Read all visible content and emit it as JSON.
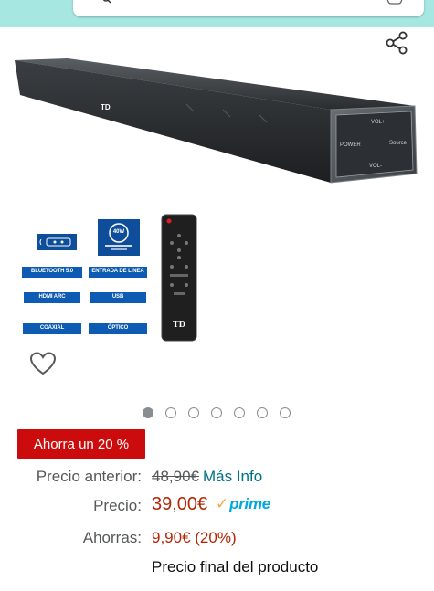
{
  "colors": {
    "top_bar": "#a6e7e2",
    "badge": "#cc0c0c",
    "price": "#b12704",
    "link": "#007185",
    "prime_blue": "#00a8e1",
    "prime_check": "#f3a847"
  },
  "header": {
    "search_icon": "search-icon",
    "right_icon": "camera-icon"
  },
  "share": {
    "icon": "share-icon"
  },
  "product": {
    "soundbar_labels": {
      "brand": "TD",
      "power": "POWER",
      "source": "Source",
      "vol_up": "VOL+",
      "vol_down": "VOL-"
    },
    "features": {
      "wattage": "40W",
      "bluetooth": "BLUETOOTH 5.0",
      "line_in": "ENTRADA DE LÍNEA",
      "hdmi": "HDMI ARC",
      "usb": "USB",
      "coaxial": "COAXIAL",
      "optical": "ÓPTICO"
    },
    "remote_brand": "TD"
  },
  "wishlist": {
    "icon": "heart-icon"
  },
  "carousel": {
    "count": 7,
    "active_index": 0
  },
  "pricing": {
    "badge": "Ahorra un 20 %",
    "previous_label": "Precio anterior:",
    "previous_value": "48,90€",
    "more_info": "Más Info",
    "price_label": "Precio:",
    "price_value": "39,00€",
    "prime": "prime",
    "savings_label": "Ahorras:",
    "savings_value": "9,90€ (20%)",
    "final_note": "Precio final del producto"
  }
}
